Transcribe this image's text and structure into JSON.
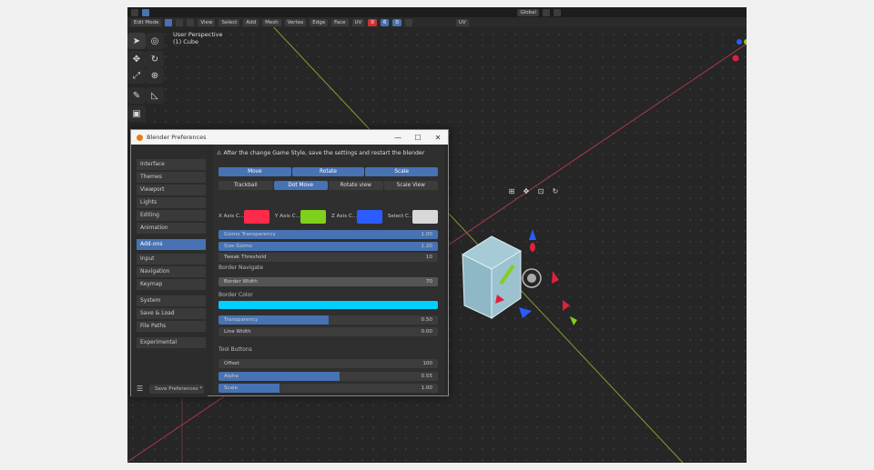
{
  "header": {
    "mode": "Edit Mode",
    "menus": [
      "View",
      "Select",
      "Add",
      "Mesh",
      "Vertex",
      "Edge",
      "Face",
      "UV"
    ],
    "counts": [
      "0",
      "6",
      "0"
    ],
    "orientation": "Global",
    "uv_label": "UV"
  },
  "viewport": {
    "label_line1": "User Perspective",
    "label_line2": "(1) Cube"
  },
  "dialog": {
    "title": "Blender Preferences",
    "warning": "After the change Game Style, save the settings and restart the blender",
    "sidebar": [
      {
        "label": "Interface",
        "active": false
      },
      {
        "label": "Themes",
        "active": false
      },
      {
        "label": "Viewport",
        "active": false
      },
      {
        "label": "Lights",
        "active": false
      },
      {
        "label": "Editing",
        "active": false
      },
      {
        "label": "Animation",
        "active": false
      },
      {
        "label": "Add-ons",
        "active": true
      },
      {
        "label": "Input",
        "active": false
      },
      {
        "label": "Navigation",
        "active": false
      },
      {
        "label": "Keymap",
        "active": false
      },
      {
        "label": "System",
        "active": false
      },
      {
        "label": "Save & Load",
        "active": false
      },
      {
        "label": "File Paths",
        "active": false
      },
      {
        "label": "Experimental",
        "active": false
      }
    ],
    "save_button": "Save Preferences *",
    "transform_buttons": [
      "Move",
      "Rotate",
      "Scale"
    ],
    "mode_buttons": [
      {
        "label": "Trackball",
        "on": false
      },
      {
        "label": "Dot Move",
        "on": true
      },
      {
        "label": "Rotate view",
        "on": false
      },
      {
        "label": "Scale View",
        "on": false
      }
    ],
    "colors": [
      {
        "label": "X Axis C...",
        "hex": "#ff2a4a"
      },
      {
        "label": "Y Axis C...",
        "hex": "#7fd11b"
      },
      {
        "label": "Z Axis C...",
        "hex": "#2a5cff"
      },
      {
        "label": "Select C...",
        "hex": "#d8d8d8"
      }
    ],
    "props_top": [
      {
        "label": "Gizmo Transparency",
        "value": "1.00",
        "fill": 1.0
      },
      {
        "label": "Size Gizmo",
        "value": "1.20",
        "fill": 1.0
      },
      {
        "label": "Tweak Threshold",
        "value": "10",
        "fill": 0.0
      }
    ],
    "border_section": "Border Navigate",
    "border_width": {
      "label": "Border Width",
      "value": "70"
    },
    "border_color_label": "Border Color",
    "border_color_hex": "#00d0ff",
    "props_border": [
      {
        "label": "Transparency",
        "value": "0.50",
        "fill": 0.5
      },
      {
        "label": "Line Width",
        "value": "0.00",
        "fill": 0.0
      }
    ],
    "tool_section": "Tool Buttons",
    "props_tool": [
      {
        "label": "Offset",
        "value": "100",
        "fill": 0.0
      },
      {
        "label": "Alpha",
        "value": "0.55",
        "fill": 0.55
      },
      {
        "label": "Scale",
        "value": "1.00",
        "fill": 0.28
      }
    ]
  }
}
